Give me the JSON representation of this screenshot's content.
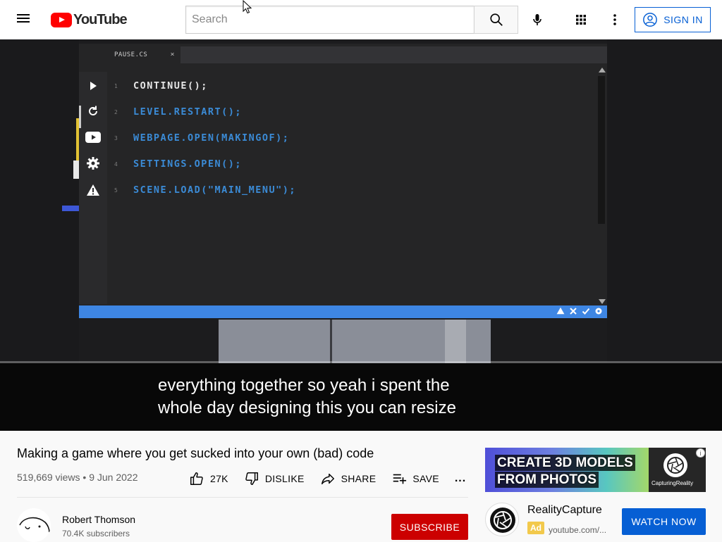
{
  "header": {
    "logo_text": "YouTube",
    "search_placeholder": "Search",
    "signin_label": "SIGN IN"
  },
  "player": {
    "editor_tab": "PAUSE.CS",
    "editor_tab_close": "×",
    "code_lines": [
      {
        "no": "1",
        "text": "CONTINUE();"
      },
      {
        "no": "2",
        "text": "LEVEL.RESTART();"
      },
      {
        "no": "3",
        "text": "WEBPAGE.OPEN(MAKINGOF);"
      },
      {
        "no": "4",
        "text": "SETTINGS.OPEN();"
      },
      {
        "no": "5",
        "text": "SCENE.LOAD(\"MAIN_MENU\");"
      }
    ],
    "caption_lines": [
      "everything together so yeah i spent the",
      "whole day designing this you can resize"
    ]
  },
  "video": {
    "title": "Making a game where you get sucked into your own (bad) code",
    "views": "519,669 views",
    "date": "9 Jun 2022",
    "meta_separator": "•",
    "likes": "27K",
    "dislike_label": "DISLIKE",
    "share_label": "SHARE",
    "save_label": "SAVE",
    "more_label": "...",
    "channel_name": "Robert Thomson",
    "subscribers": "70.4K subscribers",
    "subscribe_label": "SUBSCRIBE"
  },
  "ad": {
    "headline_line1": "CREATE 3D MODELS",
    "headline_line2": "FROM PHOTOS",
    "brand_small": "CapturingReality",
    "info_glyph": "i",
    "advertiser": "RealityCapture",
    "badge": "Ad",
    "url": "youtube.com/...",
    "cta": "WATCH NOW"
  },
  "colors": {
    "brand_red": "#ff0000",
    "link_blue": "#065fd4",
    "subscribe_red": "#cc0000",
    "code_blue": "#3b8bd6",
    "status_blue": "#3e86e3"
  },
  "icons": [
    "menu-icon",
    "youtube-logo-icon",
    "search-icon",
    "mic-icon",
    "apps-icon",
    "more-vert-icon",
    "account-icon",
    "play-icon",
    "restart-icon",
    "youtube-icon",
    "settings-icon",
    "warning-icon",
    "thumb-up-icon",
    "thumb-down-icon",
    "share-icon",
    "playlist-add-icon",
    "more-horiz-icon",
    "info-icon"
  ]
}
